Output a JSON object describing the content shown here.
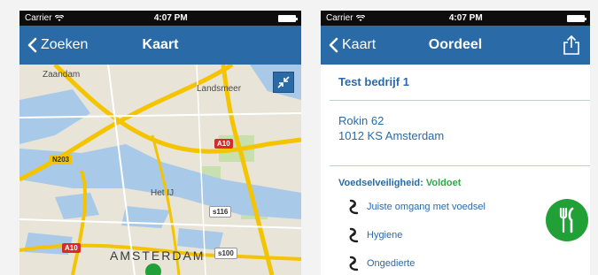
{
  "left_screen": {
    "status": {
      "carrier": "Carrier",
      "time": "4:07 PM"
    },
    "nav": {
      "back_label": "Zoeken",
      "title": "Kaart"
    },
    "map": {
      "labels": {
        "zaandam": "Zaandam",
        "landsmeer": "Landsmeer",
        "het_ij": "Het IJ",
        "amsterdam": "AMSTERDAM"
      },
      "roads": {
        "n203": "N203",
        "a10_top": "A10",
        "s116": "s116",
        "a10_bottom": "A10",
        "s100": "s100"
      }
    }
  },
  "right_screen": {
    "status": {
      "carrier": "Carrier",
      "time": "4:07 PM"
    },
    "nav": {
      "back_label": "Kaart",
      "title": "Oordeel"
    },
    "company": {
      "name": "Test bedrijf 1",
      "street": "Rokin 62",
      "postal_city": "1012 KS Amsterdam"
    },
    "food_safety": {
      "label": "Voedselveiligheid:",
      "status": "Voldoet",
      "items": [
        "Juiste omgang met voedsel",
        "Hygiene",
        "Ongedierte"
      ]
    }
  },
  "colors": {
    "nav_blue": "#2a6aa7",
    "pass_green": "#21a038",
    "text_blue": "#2a6aa7"
  }
}
